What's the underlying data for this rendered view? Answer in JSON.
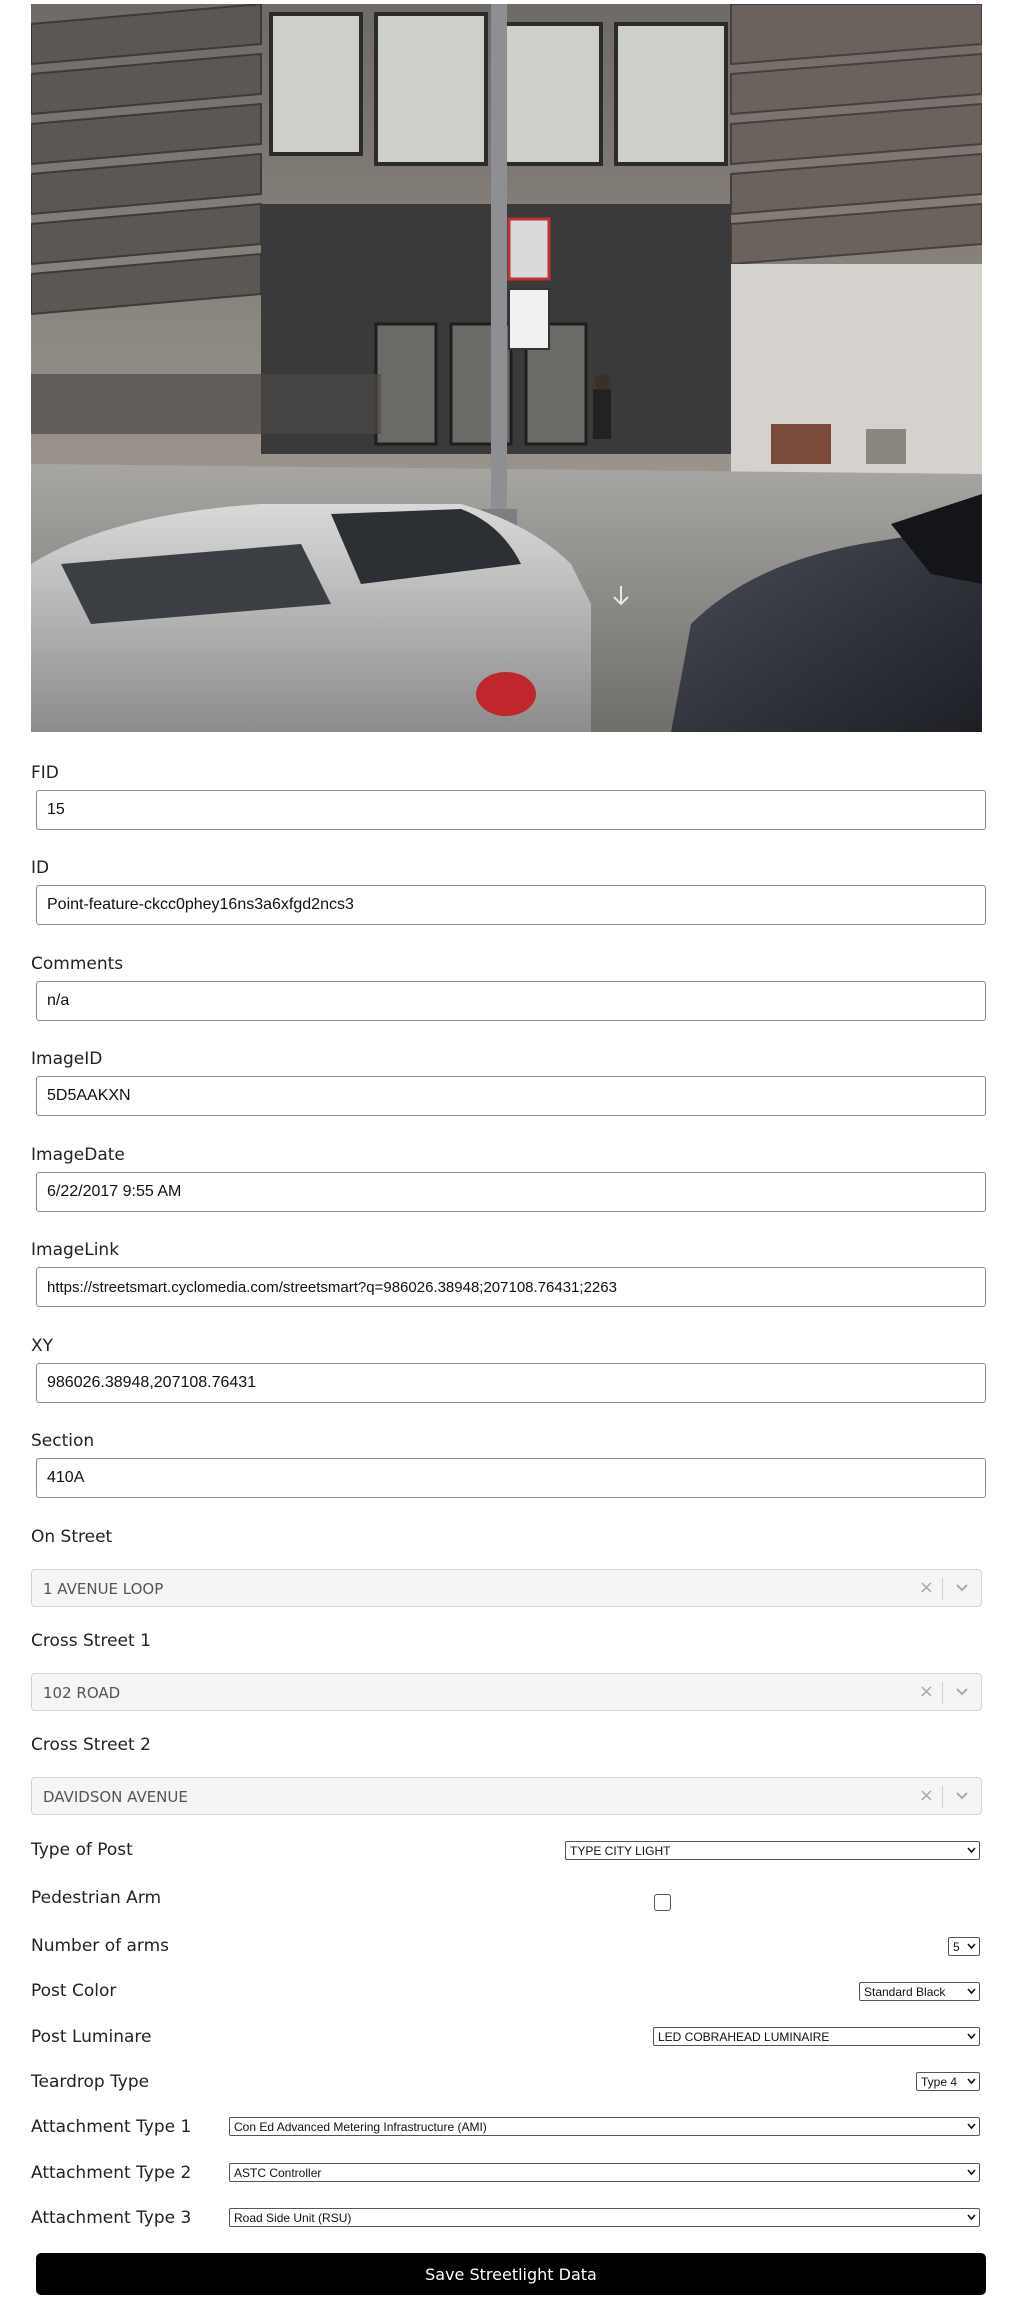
{
  "photo": {
    "alt": "Street-level image"
  },
  "fields": {
    "fid": {
      "label": "FID",
      "value": "15"
    },
    "id": {
      "label": "ID",
      "value": "Point-feature-ckcc0phey16ns3a6xfgd2ncs3"
    },
    "comments": {
      "label": "Comments",
      "value": "n/a"
    },
    "image_id": {
      "label": "ImageID",
      "value": "5D5AAKXN"
    },
    "image_date": {
      "label": "ImageDate",
      "value": "6/22/2017 9:55 AM"
    },
    "image_link": {
      "label": "ImageLink",
      "value": "https://streetsmart.cyclomedia.com/streetsmart?q=986026.38948;207108.76431;2263"
    },
    "xy": {
      "label": "XY",
      "value": "986026.38948,207108.76431"
    },
    "section": {
      "label": "Section",
      "value": "410A"
    }
  },
  "streets": {
    "on_street": {
      "label": "On Street",
      "value": "1 AVENUE LOOP"
    },
    "cross_street_1": {
      "label": "Cross Street 1",
      "value": "102 ROAD"
    },
    "cross_street_2": {
      "label": "Cross Street 2",
      "value": "DAVIDSON AVENUE"
    },
    "clear_glyph": "×"
  },
  "attributes": {
    "type_of_post": {
      "label": "Type of Post",
      "value": "TYPE CITY LIGHT"
    },
    "pedestrian_arm": {
      "label": "Pedestrian Arm",
      "checked": false
    },
    "number_of_arms": {
      "label": "Number of arms",
      "value": "5"
    },
    "post_color": {
      "label": "Post Color",
      "value": "Standard Black"
    },
    "post_luminaire": {
      "label": "Post Luminare",
      "value": "LED COBRAHEAD LUMINAIRE"
    },
    "teardrop_type": {
      "label": "Teardrop Type",
      "value": "Type 4"
    },
    "attachment_type_1": {
      "label": "Attachment Type 1",
      "value": "Con Ed Advanced Metering Infrastructure (AMI)"
    },
    "attachment_type_2": {
      "label": "Attachment Type 2",
      "value": "ASTC Controller"
    },
    "attachment_type_3": {
      "label": "Attachment Type 3",
      "value": "Road Side Unit (RSU)"
    }
  },
  "actions": {
    "save_label": "Save Streetlight Data"
  }
}
